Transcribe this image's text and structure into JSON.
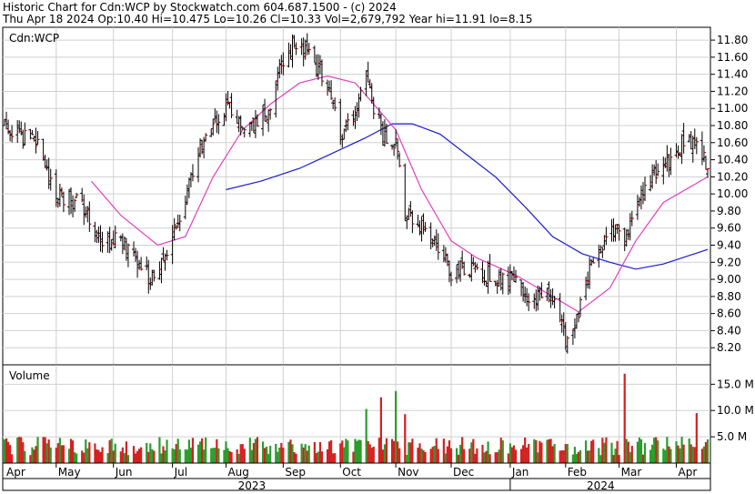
{
  "header": {
    "line1": "Historic Chart for Cdn:WCP by Stockwatch.com 604.687.1500 - (c) 2024",
    "line2": "Thu Apr 18 2024   Op:10.40   Hi=10.475   Lo=10.26   Cl=10.33   Vol=2,679,792   Year hi=11.91   lo=8.15"
  },
  "price_panel": {
    "label": "Cdn:WCP"
  },
  "volume_panel": {
    "label": "Volume"
  },
  "colors": {
    "bar_up": "#2a9d2a",
    "bar_down": "#d42020",
    "ohlc": "#000000",
    "tick_close": "#cc0000",
    "ma_short": "#e040c0",
    "ma_long": "#1a1ad0",
    "grid": "#d0d0d0"
  },
  "chart_data": [
    {
      "type": "ohlc",
      "title": "Cdn:WCP",
      "ylabel": "",
      "ylim": [
        8.0,
        11.95
      ],
      "y_ticks": [
        "8.20",
        "8.40",
        "8.60",
        "8.80",
        "9.00",
        "9.20",
        "9.40",
        "9.60",
        "9.80",
        "10.00",
        "10.20",
        "10.40",
        "10.60",
        "10.80",
        "11.00",
        "11.20",
        "11.40",
        "11.60",
        "11.80"
      ],
      "x_months": [
        "Apr",
        "May",
        "Jun",
        "Jul",
        "Aug",
        "Sep",
        "Oct",
        "Nov",
        "Dec",
        "Jan",
        "Feb",
        "Mar",
        "Apr"
      ],
      "x_years": [
        "2023",
        "2024"
      ],
      "close_path": [
        {
          "date": "2023-04-03",
          "close": 10.8
        },
        {
          "date": "2023-04-20",
          "close": 10.6
        },
        {
          "date": "2023-05-01",
          "close": 10.0
        },
        {
          "date": "2023-05-15",
          "close": 9.9
        },
        {
          "date": "2023-05-25",
          "close": 9.4
        },
        {
          "date": "2023-06-05",
          "close": 9.45
        },
        {
          "date": "2023-06-14",
          "close": 9.2
        },
        {
          "date": "2023-06-22",
          "close": 9.0
        },
        {
          "date": "2023-07-03",
          "close": 9.5
        },
        {
          "date": "2023-07-20",
          "close": 10.6
        },
        {
          "date": "2023-08-01",
          "close": 11.0
        },
        {
          "date": "2023-08-15",
          "close": 10.75
        },
        {
          "date": "2023-08-25",
          "close": 11.0
        },
        {
          "date": "2023-09-01",
          "close": 11.6
        },
        {
          "date": "2023-09-08",
          "close": 11.8
        },
        {
          "date": "2023-09-15",
          "close": 11.6
        },
        {
          "date": "2023-09-25",
          "close": 11.3
        },
        {
          "date": "2023-10-02",
          "close": 10.6
        },
        {
          "date": "2023-10-10",
          "close": 11.0
        },
        {
          "date": "2023-10-16",
          "close": 11.3
        },
        {
          "date": "2023-10-25",
          "close": 10.7
        },
        {
          "date": "2023-11-01",
          "close": 10.6
        },
        {
          "date": "2023-11-06",
          "close": 9.8
        },
        {
          "date": "2023-11-20",
          "close": 9.55
        },
        {
          "date": "2023-12-01",
          "close": 9.1
        },
        {
          "date": "2023-12-08",
          "close": 9.15
        },
        {
          "date": "2023-12-20",
          "close": 9.05
        },
        {
          "date": "2024-01-02",
          "close": 9.0
        },
        {
          "date": "2024-01-15",
          "close": 8.7
        },
        {
          "date": "2024-01-22",
          "close": 8.9
        },
        {
          "date": "2024-01-26",
          "close": 8.7
        },
        {
          "date": "2024-02-01",
          "close": 8.3
        },
        {
          "date": "2024-02-08",
          "close": 8.6
        },
        {
          "date": "2024-02-15",
          "close": 9.2
        },
        {
          "date": "2024-02-26",
          "close": 9.55
        },
        {
          "date": "2024-03-05",
          "close": 9.5
        },
        {
          "date": "2024-03-15",
          "close": 10.1
        },
        {
          "date": "2024-03-28",
          "close": 10.4
        },
        {
          "date": "2024-04-05",
          "close": 10.6
        },
        {
          "date": "2024-04-12",
          "close": 10.65
        },
        {
          "date": "2024-04-18",
          "close": 10.33
        }
      ],
      "ma_short": [
        {
          "date": "2023-05-20",
          "value": 10.15
        },
        {
          "date": "2023-06-05",
          "value": 9.75
        },
        {
          "date": "2023-06-25",
          "value": 9.4
        },
        {
          "date": "2023-07-10",
          "value": 9.5
        },
        {
          "date": "2023-07-25",
          "value": 10.2
        },
        {
          "date": "2023-08-10",
          "value": 10.75
        },
        {
          "date": "2023-08-25",
          "value": 11.05
        },
        {
          "date": "2023-09-10",
          "value": 11.3
        },
        {
          "date": "2023-09-25",
          "value": 11.38
        },
        {
          "date": "2023-10-10",
          "value": 11.3
        },
        {
          "date": "2023-10-20",
          "value": 11.05
        },
        {
          "date": "2023-11-01",
          "value": 10.75
        },
        {
          "date": "2023-11-15",
          "value": 10.05
        },
        {
          "date": "2023-12-01",
          "value": 9.45
        },
        {
          "date": "2023-12-15",
          "value": 9.25
        },
        {
          "date": "2024-01-05",
          "value": 9.05
        },
        {
          "date": "2024-01-25",
          "value": 8.8
        },
        {
          "date": "2024-02-08",
          "value": 8.62
        },
        {
          "date": "2024-02-25",
          "value": 8.9
        },
        {
          "date": "2024-03-10",
          "value": 9.45
        },
        {
          "date": "2024-03-25",
          "value": 9.9
        },
        {
          "date": "2024-04-18",
          "value": 10.2
        }
      ],
      "ma_long": [
        {
          "date": "2023-08-01",
          "value": 10.05
        },
        {
          "date": "2023-08-20",
          "value": 10.15
        },
        {
          "date": "2023-09-10",
          "value": 10.3
        },
        {
          "date": "2023-09-25",
          "value": 10.45
        },
        {
          "date": "2023-10-15",
          "value": 10.65
        },
        {
          "date": "2023-10-30",
          "value": 10.82
        },
        {
          "date": "2023-11-10",
          "value": 10.82
        },
        {
          "date": "2023-11-25",
          "value": 10.7
        },
        {
          "date": "2023-12-10",
          "value": 10.45
        },
        {
          "date": "2023-12-25",
          "value": 10.2
        },
        {
          "date": "2024-01-10",
          "value": 9.85
        },
        {
          "date": "2024-01-25",
          "value": 9.5
        },
        {
          "date": "2024-02-10",
          "value": 9.3
        },
        {
          "date": "2024-02-25",
          "value": 9.2
        },
        {
          "date": "2024-03-10",
          "value": 9.12
        },
        {
          "date": "2024-03-25",
          "value": 9.18
        },
        {
          "date": "2024-04-18",
          "value": 9.35
        }
      ]
    },
    {
      "type": "bar",
      "title": "Volume",
      "ylim": [
        0,
        18
      ],
      "y_ticks": [
        "5.0 M",
        "10.0 M",
        "15.0 M"
      ],
      "volume_spikes": [
        {
          "date": "2023-10-16",
          "value": 10.3
        },
        {
          "date": "2023-10-24",
          "value": 12.5
        },
        {
          "date": "2023-11-01",
          "value": 13.7
        },
        {
          "date": "2023-11-06",
          "value": 9.3
        },
        {
          "date": "2024-03-04",
          "value": 17.0
        },
        {
          "date": "2024-04-12",
          "value": 9.5
        }
      ]
    }
  ]
}
